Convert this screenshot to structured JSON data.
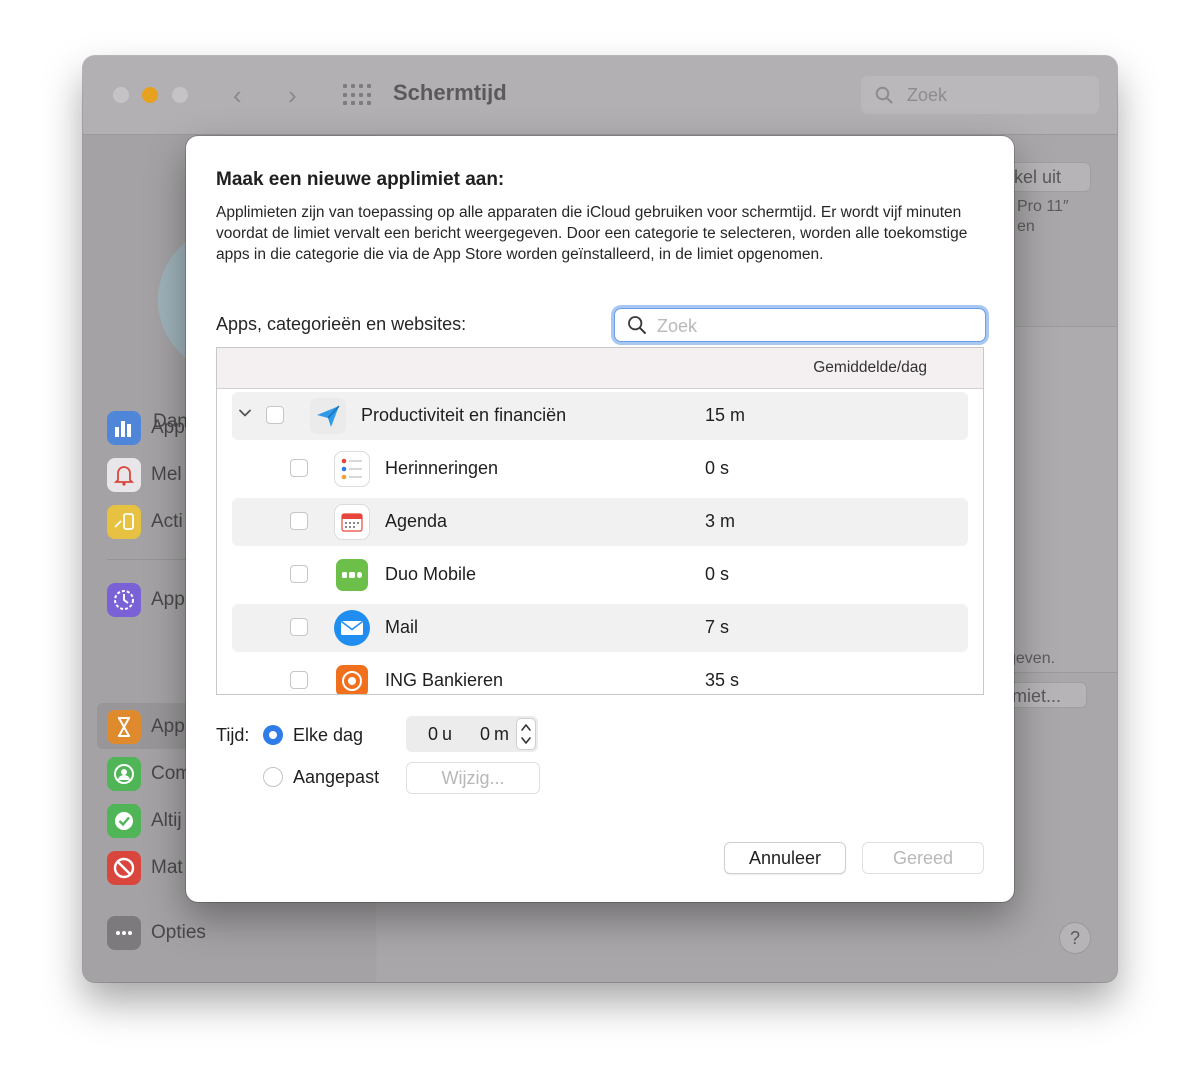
{
  "window": {
    "title": "Schermtijd",
    "search_placeholder": "Zoek",
    "back_arrow": "‹",
    "forward_arrow": "›"
  },
  "sidebar": {
    "user_name": "Dan",
    "items": [
      {
        "label": "App",
        "icon": "app-usage-icon",
        "color": "#4f86d9"
      },
      {
        "label": "Mel",
        "icon": "notifications-bell-icon",
        "color": "#e8e6e8"
      },
      {
        "label": "Acti",
        "icon": "pickups-icon",
        "color": "#e7c142"
      },
      {
        "label": "App",
        "icon": "downtime-icon",
        "color": "#7a62d6"
      },
      {
        "label": "App",
        "icon": "hourglass-icon",
        "color": "#e08a2e"
      },
      {
        "label": "Com",
        "icon": "communication-icon",
        "color": "#4fb557"
      },
      {
        "label": "Altij",
        "icon": "always-allowed-icon",
        "color": "#4fb557"
      },
      {
        "label": "Mat",
        "icon": "restrictions-icon",
        "color": "#d9463e"
      }
    ],
    "options_label": "Opties"
  },
  "background": {
    "disable_button": "akel uit",
    "device_line1": "Pro 11″",
    "device_line2": "en",
    "footer_text": "geven.",
    "limit_button": "imiet...",
    "help": "?"
  },
  "dialog": {
    "title": "Maak een nieuwe applimiet aan:",
    "description": "Applimieten zijn van toepassing op alle apparaten die iCloud gebruiken voor schermtijd. Er wordt vijf minuten voordat de limiet vervalt een bericht weergegeven. Door een categorie te selecteren, worden alle toekomstige apps in die categorie die via de App Store worden geïnstalleerd, in de limiet opgenomen.",
    "list_label": "Apps, categorieën en websites:",
    "search_placeholder": "Zoek",
    "column_header": "Gemiddelde/dag",
    "category": {
      "name": "Productiviteit en financiën",
      "value": "15 m",
      "icon": "paper-plane-icon",
      "color": "#2f9be8"
    },
    "apps": [
      {
        "name": "Herinneringen",
        "value": "0 s",
        "icon": "reminders-icon"
      },
      {
        "name": "Agenda",
        "value": "3 m",
        "icon": "calendar-icon"
      },
      {
        "name": "Duo Mobile",
        "value": "0 s",
        "icon": "duo-mobile-icon"
      },
      {
        "name": "Mail",
        "value": "7 s",
        "icon": "mail-icon"
      },
      {
        "name": "ING Bankieren",
        "value": "35 s",
        "icon": "ing-lion-icon"
      }
    ],
    "time_label": "Tijd:",
    "every_day": "Elke dag",
    "custom": "Aangepast",
    "hours": "0",
    "hours_unit": "u",
    "minutes": "0",
    "minutes_unit": "m",
    "edit_button": "Wijzig...",
    "cancel_button": "Annuleer",
    "done_button": "Gereed",
    "accent_color": "#2f7ce8"
  }
}
